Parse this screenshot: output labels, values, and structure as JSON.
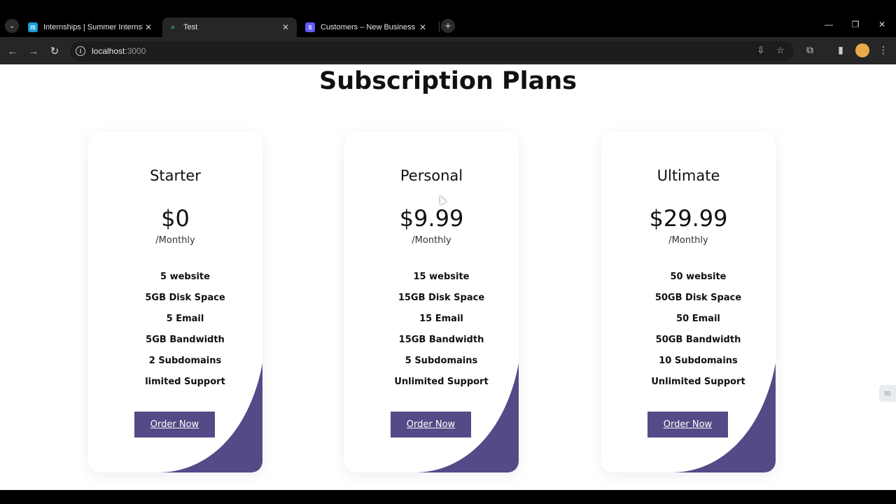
{
  "browser": {
    "tabs": [
      {
        "title": "Internships | Summer Internshi",
        "favicon_text": "IS",
        "favicon_color": "#1d9bd7",
        "active": false
      },
      {
        "title": "Test",
        "favicon_text": "⚛",
        "favicon_color": "#3c3c3c",
        "active": true
      },
      {
        "title": "Customers – New Business – S",
        "favicon_text": "S",
        "favicon_color": "#635bff",
        "active": false
      }
    ],
    "url_host": "localhost",
    "url_port": ":3000"
  },
  "page": {
    "title": "Subscription Plans",
    "plans": [
      {
        "name": "Starter",
        "price": "$0",
        "period": "/Monthly",
        "features": [
          "5 website",
          "5GB Disk Space",
          "5 Email",
          "5GB Bandwidth",
          "2 Subdomains",
          "limited Support"
        ],
        "button": "Order Now"
      },
      {
        "name": "Personal",
        "price": "$9.99",
        "period": "/Monthly",
        "features": [
          "15 website",
          "15GB Disk Space",
          "15 Email",
          "15GB Bandwidth",
          "5 Subdomains",
          "Unlimited Support"
        ],
        "button": "Order Now"
      },
      {
        "name": "Ultimate",
        "price": "$29.99",
        "period": "/Monthly",
        "features": [
          "50 website",
          "50GB Disk Space",
          "50 Email",
          "50GB Bandwidth",
          "10 Subdomains",
          "Unlimited Support"
        ],
        "button": "Order Now"
      }
    ],
    "accent_color": "#534a87"
  }
}
